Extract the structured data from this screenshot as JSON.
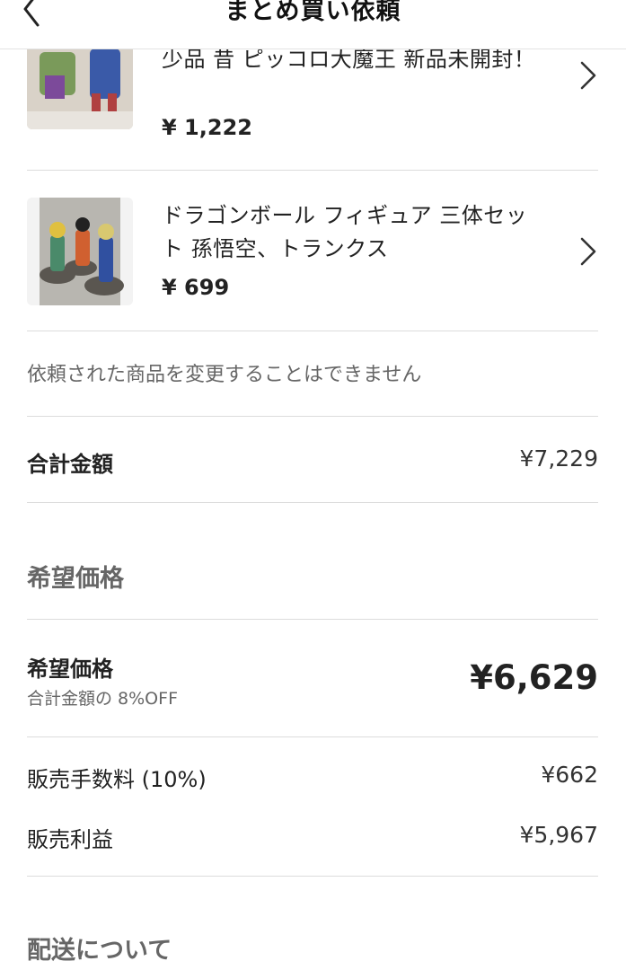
{
  "header": {
    "title": "まとめ買い依頼",
    "back_icon": "chevron-left-icon"
  },
  "items": [
    {
      "title": "少品 昔 ピッコロ大魔王 新品未開封！",
      "price": "¥ 1,222"
    },
    {
      "title": "ドラゴンボール フィギュア 三体セット 孫悟空、トランクス",
      "price": "¥ 699"
    }
  ],
  "note": "依頼された商品を変更することはできません",
  "total": {
    "label": "合計金額",
    "value": "¥7,229"
  },
  "desired_section": {
    "heading": "希望価格"
  },
  "desired": {
    "label": "希望価格",
    "sub": "合計金額の 8%OFF",
    "value": "¥6,629"
  },
  "fee": {
    "label": "販売手数料 (10%)",
    "value": "¥662"
  },
  "profit": {
    "label": "販売利益",
    "value": "¥5,967"
  },
  "shipping_section": {
    "heading": "配送について"
  },
  "colors": {
    "text": "#222222",
    "muted": "#666666",
    "divider": "#dcdcdc"
  }
}
